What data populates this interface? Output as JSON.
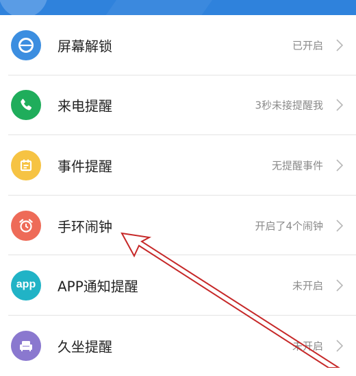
{
  "colors": {
    "header": "#2f82dc",
    "screen_unlock_icon": "#3c8ee0",
    "call_reminder_icon": "#1fad5b",
    "event_reminder_icon": "#f6c343",
    "alarm_icon": "#ee6b58",
    "app_notification_icon": "#21b3c6",
    "sedentary_icon": "#8a78cf",
    "annotation_arrow": "#c62828"
  },
  "settings": {
    "items": [
      {
        "label": "屏幕解锁",
        "status": "已开启",
        "icon": "lock-icon"
      },
      {
        "label": "来电提醒",
        "status": "3秒未接提醒我",
        "icon": "phone-icon"
      },
      {
        "label": "事件提醒",
        "status": "无提醒事件",
        "icon": "calendar-icon"
      },
      {
        "label": "手环闹钟",
        "status": "开启了4个闹钟",
        "icon": "alarm-clock-icon"
      },
      {
        "label": "APP通知提醒",
        "status": "未开启",
        "icon": "app-icon",
        "icon_text": "app"
      },
      {
        "label": "久坐提醒",
        "status": "未开启",
        "icon": "sofa-icon"
      }
    ]
  },
  "annotation": {
    "type": "arrow",
    "points_to": "手环闹钟"
  }
}
